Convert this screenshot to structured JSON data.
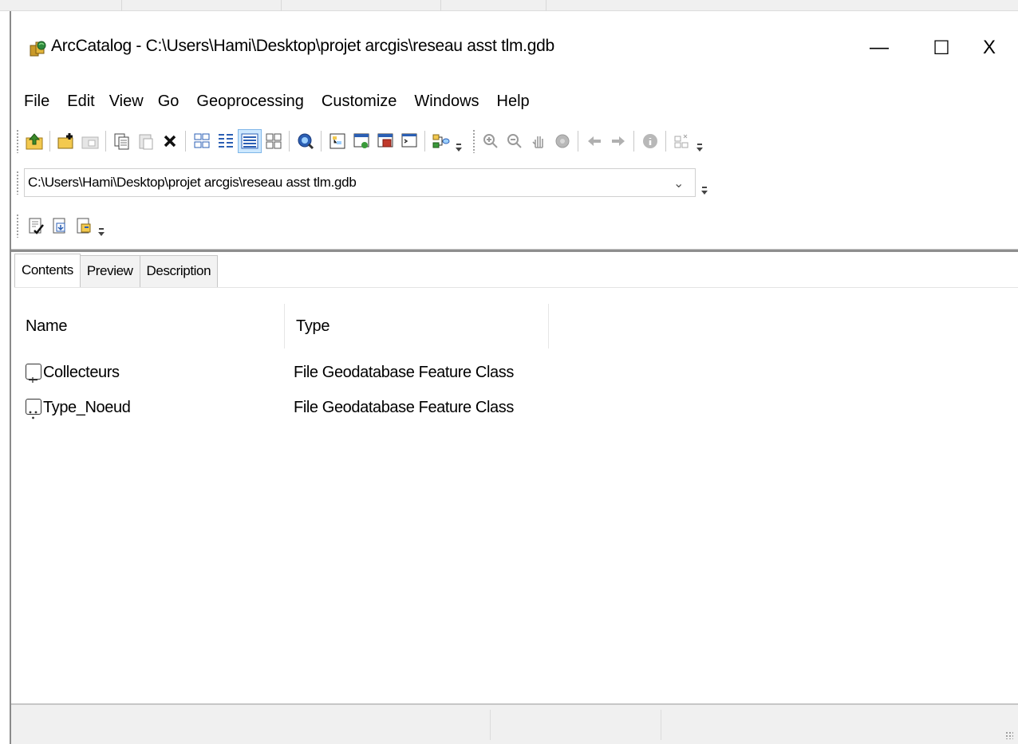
{
  "window": {
    "title": "ArcCatalog - C:\\Users\\Hami\\Desktop\\projet arcgis\\reseau asst tlm.gdb",
    "minimize_glyph": "—",
    "maximize_glyph": "☐",
    "close_glyph": "X"
  },
  "menu": [
    "File",
    "Edit",
    "View",
    "Go",
    "Geoprocessing",
    "Customize",
    "Windows",
    "Help"
  ],
  "toolbar": {
    "icons": [
      "up-one-level-icon",
      "connect-folder-icon",
      "disconnect-folder-icon",
      "copy-icon",
      "paste-icon",
      "delete-icon",
      "large-icons-icon",
      "list-icon",
      "details-icon",
      "thumbnails-icon",
      "launch-arcmap-icon",
      "catalog-tree-icon",
      "search-window-icon",
      "arctoolbox-icon",
      "python-window-icon",
      "modelbuilder-icon",
      "zoom-in-icon",
      "zoom-out-icon",
      "pan-icon",
      "full-extent-icon",
      "back-icon",
      "forward-icon",
      "identify-icon",
      "create-thumbnail-icon"
    ]
  },
  "location": {
    "value": "C:\\Users\\Hami\\Desktop\\projet arcgis\\reseau asst tlm.gdb"
  },
  "metadata_toolbar": {
    "icons": [
      "edit-metadata-icon",
      "import-metadata-icon",
      "export-metadata-icon"
    ]
  },
  "tabs": [
    {
      "label": "Contents",
      "active": true
    },
    {
      "label": "Preview",
      "active": false
    },
    {
      "label": "Description",
      "active": false
    }
  ],
  "contents": {
    "columns": [
      "Name",
      "Type"
    ],
    "rows": [
      {
        "name": "Collecteurs",
        "type": "File Geodatabase Feature Class",
        "icon": "line-feature-class-icon"
      },
      {
        "name": "Type_Noeud",
        "type": "File Geodatabase Feature Class",
        "icon": "point-feature-class-icon"
      }
    ]
  },
  "colors": {
    "accent_blue": "#2b5fb4",
    "selected_view_bg": "#cde8ff"
  }
}
